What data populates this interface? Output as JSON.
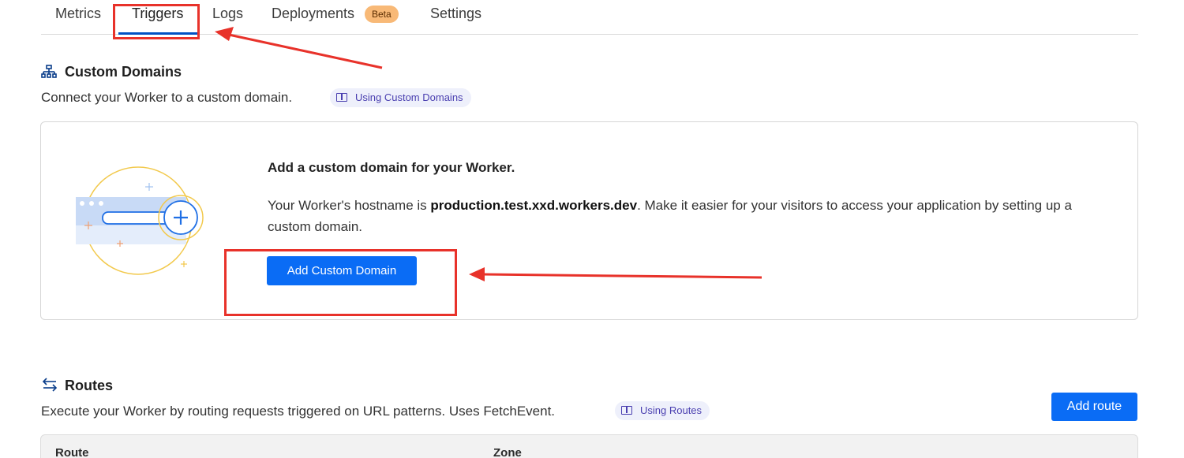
{
  "tabs": [
    {
      "label": "Metrics"
    },
    {
      "label": "Triggers"
    },
    {
      "label": "Logs"
    },
    {
      "label": "Deployments",
      "badge": "Beta"
    },
    {
      "label": "Settings"
    }
  ],
  "active_tab": "Triggers",
  "custom_domains": {
    "title": "Custom Domains",
    "description": "Connect your Worker to a custom domain.",
    "doc_link": "Using Custom Domains",
    "card": {
      "heading": "Add a custom domain for your Worker.",
      "body_prefix": "Your Worker's hostname is ",
      "hostname": "production.test.xxd.workers.dev",
      "body_suffix": ". Make it easier for your visitors to access your application by setting up a custom domain.",
      "button": "Add Custom Domain"
    }
  },
  "routes": {
    "title": "Routes",
    "description": "Execute your Worker by routing requests triggered on URL patterns. Uses FetchEvent.",
    "doc_link": "Using Routes",
    "add_button": "Add route",
    "columns": [
      "Route",
      "Zone"
    ]
  },
  "colors": {
    "accent": "#0a6cf5",
    "annotation": "#e8322a",
    "badge": "#f8b977",
    "active_tab_underline": "#0051c3"
  }
}
